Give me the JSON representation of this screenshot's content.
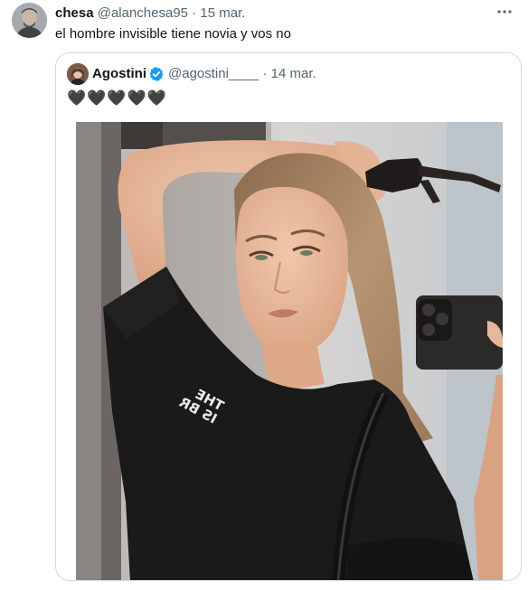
{
  "tweet": {
    "display_name": "chesa",
    "handle": "@alanchesa95",
    "separator": "·",
    "date": "15 mar.",
    "text": "el hombre invisible tiene novia y vos no",
    "more_label": "···"
  },
  "quoted_tweet": {
    "display_name": "Agostini",
    "handle": "@agostini____",
    "separator": "·",
    "date": "14 mar.",
    "text": "🖤🖤🖤🖤🖤",
    "photo": {
      "shirt_text_line1": "THE",
      "shirt_text_line2": "IS BR"
    }
  },
  "colors": {
    "verified": "#1d9bf0",
    "text_secondary": "#536471",
    "border": "#cfd9de"
  }
}
